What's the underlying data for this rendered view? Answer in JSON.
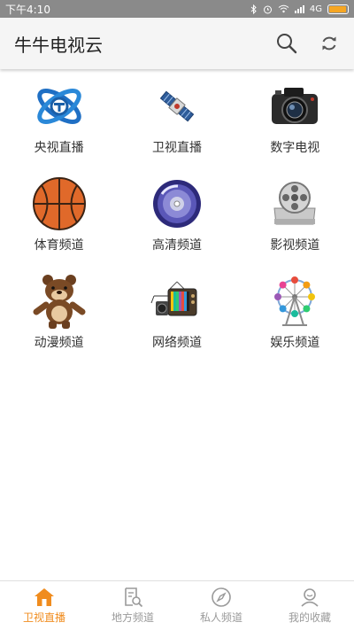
{
  "status_bar": {
    "time": "下午4:10",
    "network": "4G",
    "battery_level": 0.95
  },
  "app_bar": {
    "title": "牛牛电视云",
    "search_icon": "search-icon",
    "refresh_icon": "refresh-icon"
  },
  "channels": [
    {
      "label": "央视直播",
      "icon": "cctv-logo-icon"
    },
    {
      "label": "卫视直播",
      "icon": "satellite-icon"
    },
    {
      "label": "数字电视",
      "icon": "camera-icon"
    },
    {
      "label": "体育频道",
      "icon": "basketball-icon"
    },
    {
      "label": "高清频道",
      "icon": "disc-icon"
    },
    {
      "label": "影视频道",
      "icon": "film-reel-icon"
    },
    {
      "label": "动漫频道",
      "icon": "bear-icon"
    },
    {
      "label": "网络频道",
      "icon": "tv-set-icon"
    },
    {
      "label": "娱乐频道",
      "icon": "ferris-wheel-icon"
    }
  ],
  "bottom_nav": [
    {
      "label": "卫视直播",
      "icon": "home-icon",
      "active": true
    },
    {
      "label": "地方频道",
      "icon": "document-search-icon",
      "active": false
    },
    {
      "label": "私人频道",
      "icon": "compass-icon",
      "active": false
    },
    {
      "label": "我的收藏",
      "icon": "user-icon",
      "active": false
    }
  ],
  "colors": {
    "accent": "#f08c1e",
    "inactive": "#9a9a9a"
  }
}
